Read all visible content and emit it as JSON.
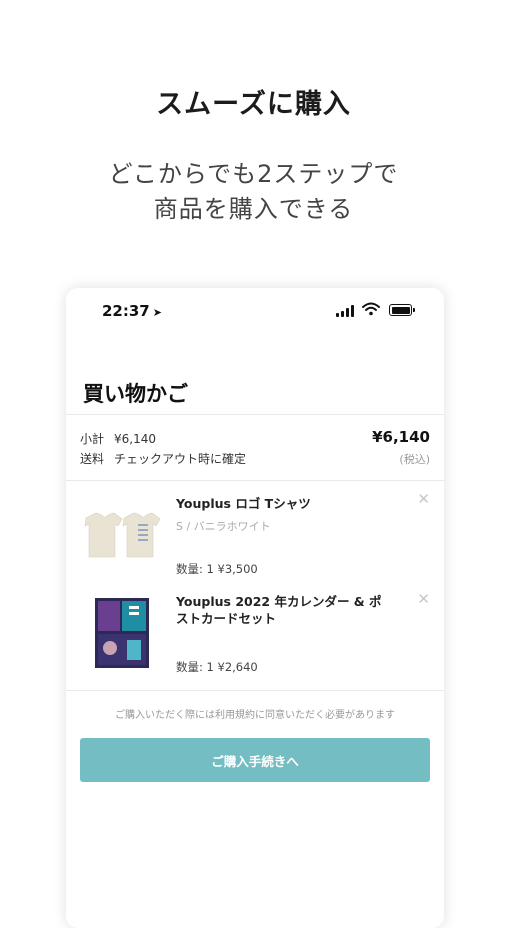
{
  "promo": {
    "headline": "スムーズに購入",
    "subline_1": "どこからでも2ステップで",
    "subline_2": "商品を購入できる"
  },
  "status_bar": {
    "time": "22:37",
    "icons": [
      "location-arrow-icon",
      "signal-icon",
      "wifi-icon",
      "battery-icon"
    ]
  },
  "cart": {
    "title": "買い物かご",
    "subtotal_label": "小計",
    "subtotal_value": "¥6,140",
    "shipping_label": "送料",
    "shipping_value": "チェックアウト時に確定",
    "total": "¥6,140",
    "tax_note": "(税込)",
    "items": [
      {
        "name": "Youplus ロゴ Tシャツ",
        "variant": "S / バニラホワイト",
        "qty": "数量: 1  ¥3,500",
        "image": "tshirt-image"
      },
      {
        "name": "Youplus 2022 年カレンダー & ポストカードセット",
        "variant": "",
        "qty": "数量: 1  ¥2,640",
        "image": "calendar-image"
      }
    ],
    "notice": "ご購入いただく際には利用規約に同意いただく必要があります",
    "checkout_label": "ご購入手続きへ"
  },
  "colors": {
    "accent": "#74bec3",
    "background": "#ffffff",
    "text": "#222222"
  }
}
